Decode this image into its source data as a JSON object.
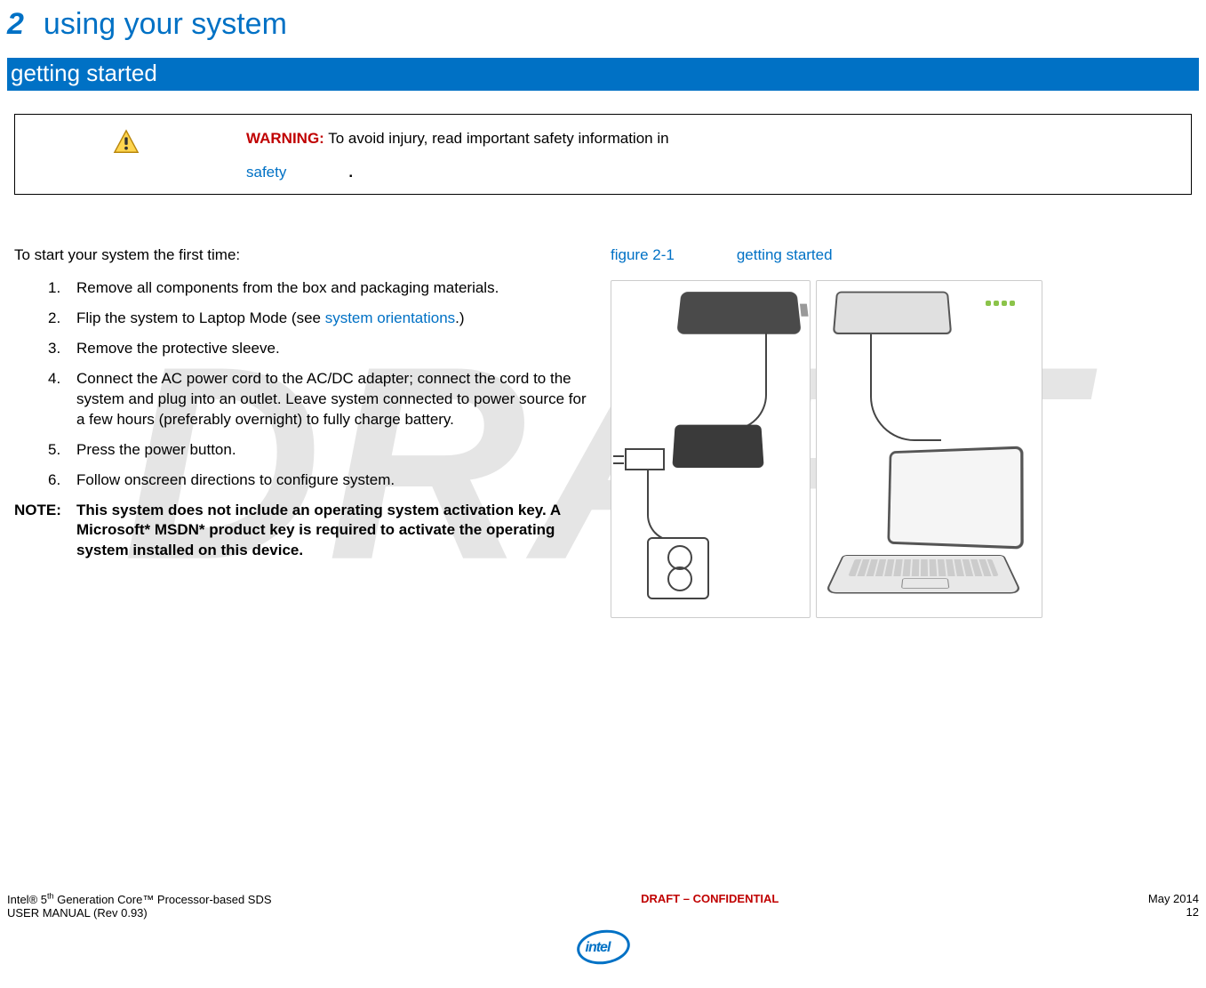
{
  "watermark": "DRAFT",
  "chapter": {
    "number": "2",
    "title": "using your system"
  },
  "section": "getting started",
  "warning": {
    "label": "WARNING:",
    "text": " To avoid injury, read important safety information in",
    "link": "safety",
    "period": "."
  },
  "intro": "To start your system the first time:",
  "steps": [
    {
      "num": "1.",
      "text": "Remove all components from the box and packaging materials."
    },
    {
      "num": "2.",
      "text_before": "Flip the system to Laptop Mode (see ",
      "link": "system orientations",
      "text_after": ".)"
    },
    {
      "num": "3.",
      "text": "Remove the protective sleeve."
    },
    {
      "num": "4.",
      "text": "Connect the AC power cord to the AC/DC adapter; connect the cord to the system and plug into an outlet. Leave system connected to power source for a few hours (preferably overnight) to fully charge battery."
    },
    {
      "num": "5.",
      "text": "Press the power button."
    },
    {
      "num": "6.",
      "text": "Follow onscreen directions to configure system."
    }
  ],
  "note": {
    "label": "NOTE:",
    "text": "This system does not include an operating system activation key.  A Microsoft* MSDN* product key is required to activate the operating system installed on this device."
  },
  "figure": {
    "label": "figure 2-1",
    "caption": "getting started"
  },
  "footer": {
    "left_line1": "Intel® 5th Generation Core™ Processor-based SDS",
    "left_line2": "USER MANUAL (Rev 0.93)",
    "center": "DRAFT – CONFIDENTIAL",
    "right_line1": "May 2014",
    "right_line2": "12",
    "logo": "intel"
  }
}
